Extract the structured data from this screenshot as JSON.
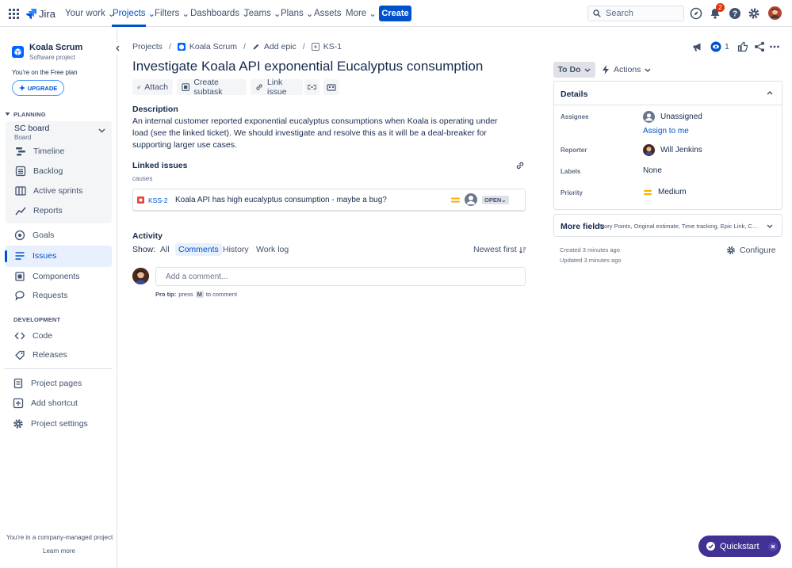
{
  "topnav": {
    "logo_text": "Jira",
    "items": [
      {
        "label": "Your work"
      },
      {
        "label": "Projects"
      },
      {
        "label": "Filters"
      },
      {
        "label": "Dashboards"
      },
      {
        "label": "Teams"
      },
      {
        "label": "Plans"
      },
      {
        "label": "Assets"
      },
      {
        "label": "More"
      }
    ],
    "create_label": "Create",
    "search_placeholder": "Search",
    "notification_count": "2",
    "accent_color": "#0052cc"
  },
  "sidebar": {
    "project_name": "Koala Scrum",
    "project_type": "Software project",
    "free_plan": "You're on the Free plan",
    "upgrade_label": "UPGRADE",
    "planning_label": "PLANNING",
    "board_name": "SC board",
    "board_sub": "Board",
    "planning_items": [
      {
        "label": "Timeline",
        "icon": "timeline-icon"
      },
      {
        "label": "Backlog",
        "icon": "backlog-icon"
      },
      {
        "label": "Active sprints",
        "icon": "board-icon"
      },
      {
        "label": "Reports",
        "icon": "reports-icon"
      }
    ],
    "main_items": [
      {
        "label": "Goals",
        "icon": "goals-icon"
      },
      {
        "label": "Issues",
        "icon": "issues-icon"
      },
      {
        "label": "Components",
        "icon": "components-icon"
      },
      {
        "label": "Requests",
        "icon": "requests-icon"
      }
    ],
    "development_label": "DEVELOPMENT",
    "dev_items": [
      {
        "label": "Code",
        "icon": "code-icon"
      },
      {
        "label": "Releases",
        "icon": "releases-icon"
      }
    ],
    "bottom_items": [
      {
        "label": "Project pages",
        "icon": "pages-icon"
      },
      {
        "label": "Add shortcut",
        "icon": "add-shortcut-icon"
      },
      {
        "label": "Project settings",
        "icon": "settings-icon"
      }
    ],
    "footer_text": "You're in a company-managed project",
    "learn_more": "Learn more"
  },
  "issue": {
    "breadcrumbs": [
      "Projects",
      "Koala Scrum",
      "Add epic",
      "KS-1"
    ],
    "title": "Investigate Koala API exponential Eucalyptus consumption",
    "toolbar": {
      "attach": "Attach",
      "create_subtask": "Create subtask",
      "link_issue": "Link issue"
    },
    "description_heading": "Description",
    "description": "An internal customer reported exponential eucalyptus consumptions when Koala is operating under load (see the linked ticket). We should investigate and resolve this as it will be a deal-breaker for supporting larger use cases.",
    "linked_heading": "Linked issues",
    "link_type": "causes",
    "linked_issue": {
      "key": "KSS-2",
      "summary": "Koala API has high eucalyptus consumption - maybe a bug?",
      "status": "OPEN"
    },
    "activity_heading": "Activity",
    "show_label": "Show:",
    "activity_tabs": [
      "All",
      "Comments",
      "History",
      "Work log"
    ],
    "sort_label": "Newest first",
    "comment_placeholder": "Add a comment...",
    "protip_prefix": "Pro tip:",
    "protip_press": "press",
    "protip_key": "M",
    "protip_suffix": "to comment"
  },
  "panel": {
    "watch_count": "1",
    "status": "To Do",
    "actions": "Actions",
    "details_heading": "Details",
    "assignee_label": "Assignee",
    "assignee_value": "Unassigned",
    "assign_to_me": "Assign to me",
    "reporter_label": "Reporter",
    "reporter_value": "Will Jenkins",
    "labels_label": "Labels",
    "labels_value": "None",
    "priority_label": "Priority",
    "priority_value": "Medium",
    "more_fields": "More fields",
    "more_fields_sub": "Story Points, Original estimate, Time tracking, Epic Link, Components",
    "created": "Created 3 minutes ago",
    "updated": "Updated 3 minutes ago",
    "configure": "Configure"
  },
  "quickstart": {
    "label": "Quickstart"
  }
}
